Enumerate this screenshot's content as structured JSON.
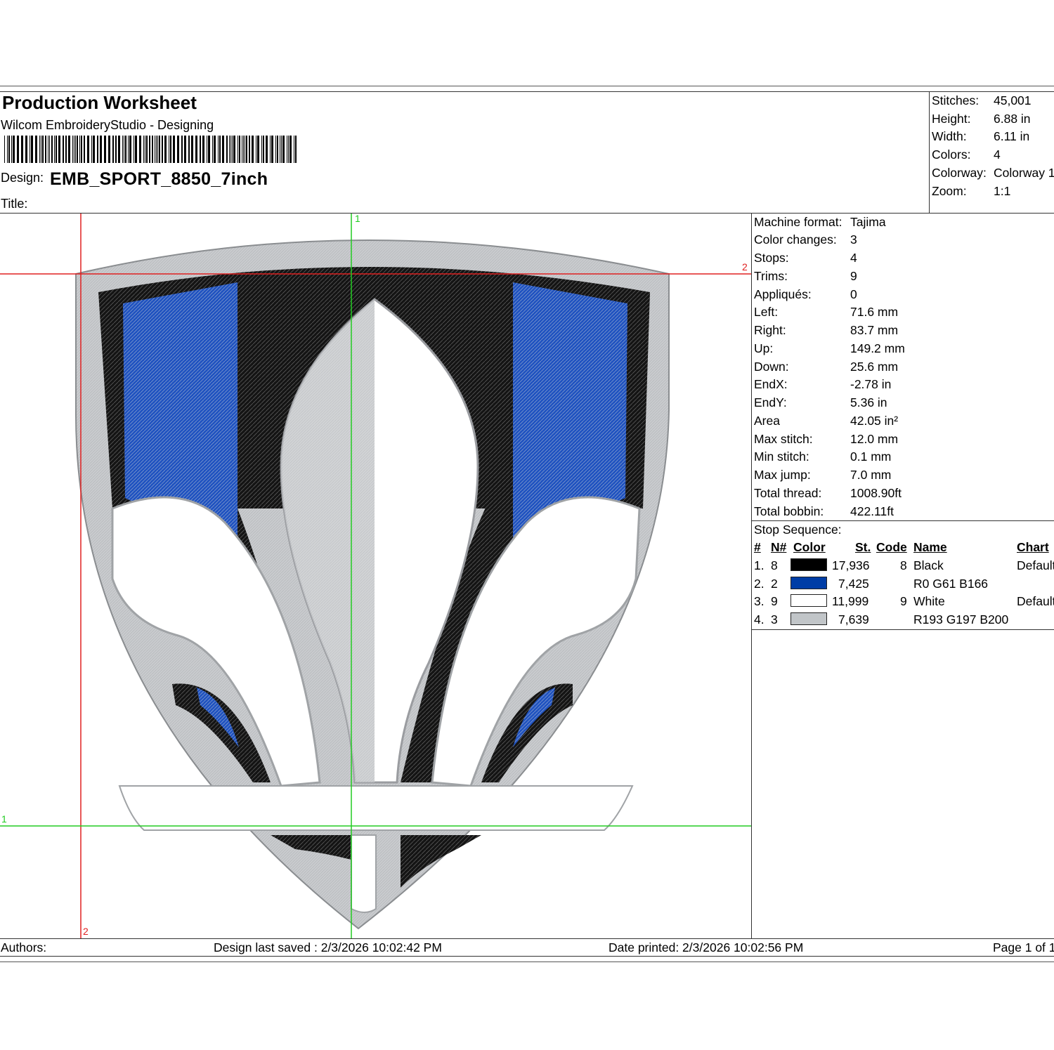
{
  "header": {
    "title": "Production Worksheet",
    "subtitle": "Wilcom EmbroideryStudio - Designing",
    "design_label": "Design:",
    "design_name": "EMB_SPORT_8850_7inch",
    "title_label": "Title:"
  },
  "summary": [
    {
      "label": "Stitches:",
      "value": "45,001"
    },
    {
      "label": "Height:",
      "value": "6.88 in"
    },
    {
      "label": "Width:",
      "value": "6.11 in"
    },
    {
      "label": "Colors:",
      "value": "4"
    },
    {
      "label": "Colorway:",
      "value": "Colorway 1"
    },
    {
      "label": "Zoom:",
      "value": "1:1"
    }
  ],
  "machine_stats": [
    {
      "label": "Machine format:",
      "value": "Tajima"
    },
    {
      "label": "Color changes:",
      "value": "3"
    },
    {
      "label": "Stops:",
      "value": "4"
    },
    {
      "label": "Trims:",
      "value": "9"
    },
    {
      "label": "Appliqués:",
      "value": "0"
    },
    {
      "label": "Left:",
      "value": "71.6 mm"
    },
    {
      "label": "Right:",
      "value": "83.7 mm"
    },
    {
      "label": "Up:",
      "value": "149.2 mm"
    },
    {
      "label": "Down:",
      "value": "25.6 mm"
    },
    {
      "label": "EndX:",
      "value": "-2.78 in"
    },
    {
      "label": "EndY:",
      "value": "5.36 in"
    },
    {
      "label": "Area",
      "value": " 42.05 in²"
    },
    {
      "label": "Max stitch:",
      "value": "12.0 mm"
    },
    {
      "label": "Min stitch:",
      "value": "0.1 mm"
    },
    {
      "label": "Max jump:",
      "value": "7.0 mm"
    },
    {
      "label": "Total thread:",
      "value": "1008.90ft"
    },
    {
      "label": "Total bobbin:",
      "value": "422.11ft"
    }
  ],
  "stop_sequence": {
    "title": "Stop Sequence:",
    "headers": {
      "num": "#",
      "needle": "N#",
      "color": "Color",
      "stitches": "St.",
      "code": "Code",
      "name": "Name",
      "chart": "Chart"
    },
    "rows": [
      {
        "num": "1.",
        "needle": "8",
        "swatch": "#000000",
        "stitches": "17,936",
        "code": "8",
        "name": "Black",
        "chart": "Default"
      },
      {
        "num": "2.",
        "needle": "2",
        "swatch": "#003da6",
        "stitches": "7,425",
        "code": "",
        "name": "R0 G61 B166",
        "chart": ""
      },
      {
        "num": "3.",
        "needle": "9",
        "swatch": "#ffffff",
        "stitches": "11,999",
        "code": "9",
        "name": "White",
        "chart": "Default"
      },
      {
        "num": "4.",
        "needle": "3",
        "swatch": "#c1c5c8",
        "stitches": "7,639",
        "code": "",
        "name": "R193 G197 B200",
        "chart": ""
      }
    ]
  },
  "footer": {
    "authors": "Authors:",
    "saved": "Design last saved : 2/3/2026 10:02:42 PM",
    "printed": "Date printed: 2/3/2026 10:02:56 PM",
    "page": "Page 1 of 1"
  },
  "guides": {
    "one": "1",
    "two": "2"
  },
  "colors": {
    "black": "#111111",
    "blue": "#1f4fb8",
    "white": "#ffffff",
    "gray": "#c1c5c8",
    "red_guide": "#e02020",
    "green_guide": "#22cc22"
  }
}
